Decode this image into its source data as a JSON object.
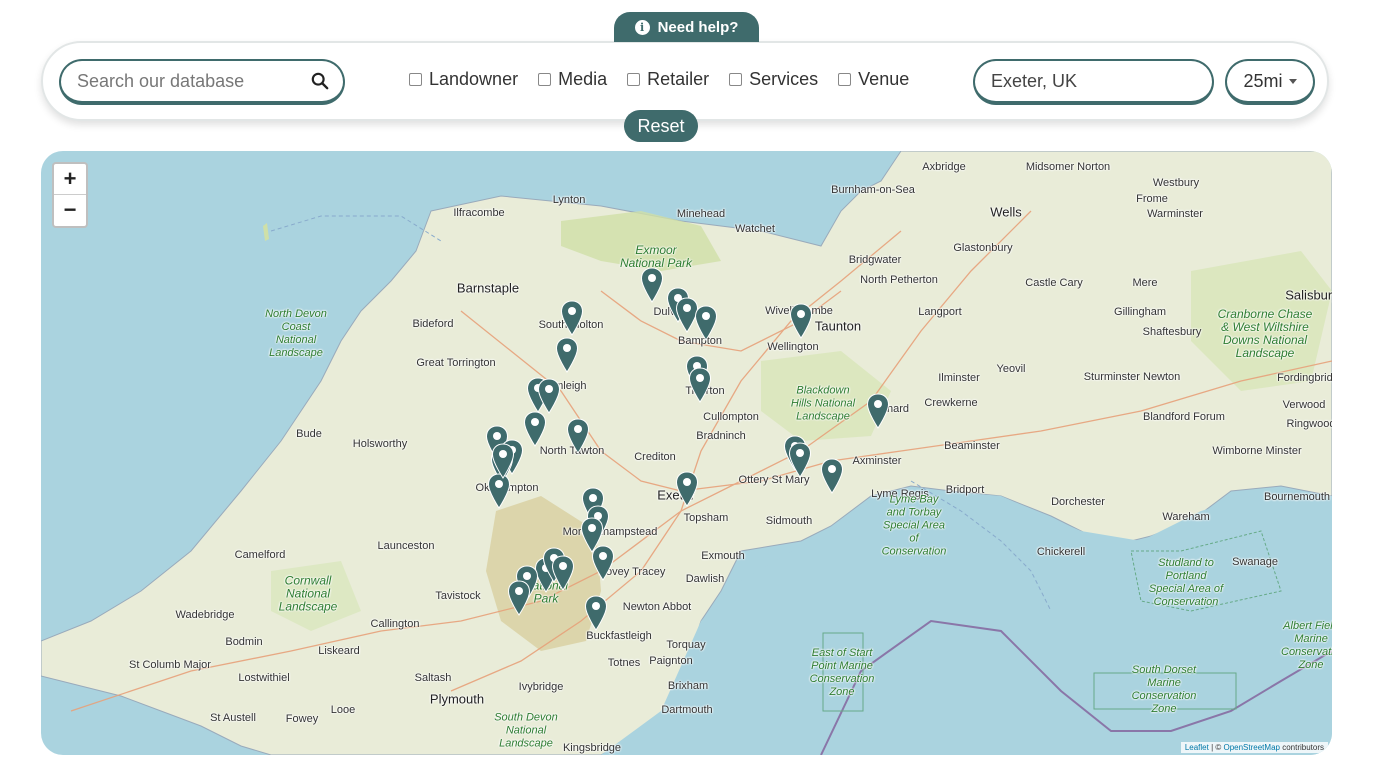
{
  "help": {
    "label": "Need help?"
  },
  "search": {
    "placeholder": "Search our database",
    "value": ""
  },
  "filters": [
    {
      "label": "Landowner",
      "checked": false
    },
    {
      "label": "Media",
      "checked": false
    },
    {
      "label": "Retailer",
      "checked": false
    },
    {
      "label": "Services",
      "checked": false
    },
    {
      "label": "Venue",
      "checked": false
    }
  ],
  "location": {
    "value": "Exeter, UK"
  },
  "radius": {
    "value": "25mi"
  },
  "reset": {
    "label": "Reset"
  },
  "map": {
    "zoom_in": "+",
    "zoom_out": "−",
    "attribution": {
      "leaflet": "Leaflet",
      "sep": " | © ",
      "osm": "OpenStreetMap",
      "rest": " contributors"
    },
    "places": [
      "Axbridge",
      "Midsomer Norton",
      "Westbury",
      "Wells",
      "Frome",
      "Warminster",
      "Burnham-on-Sea",
      "Ilfracombe",
      "Lynton",
      "Minehead",
      "Watchet",
      "Bridgwater",
      "Glastonbury",
      "Barnstaple",
      "North Petherton",
      "Castle Cary",
      "Mere",
      "Salisbury",
      "Bideford",
      "South Molton",
      "Dulverton",
      "Wiveliscombe",
      "Taunton",
      "Langport",
      "Gillingham",
      "Shaftesbury",
      "Bampton",
      "Wellington",
      "Great Torrington",
      "Chulmleigh",
      "Tiverton",
      "Ilminster",
      "Yeovil",
      "Sturminster Newton",
      "Fordingbridge",
      "Cullompton",
      "Chard",
      "Crewkerne",
      "Blandford Forum",
      "Verwood",
      "Ringwood",
      "Bude",
      "Holsworthy",
      "Bradninch",
      "North Tawton",
      "Crediton",
      "Beaminster",
      "Wimborne Minster",
      "Axminster",
      "Ottery St Mary",
      "Okehampton",
      "Exeter",
      "Lyme Regis",
      "Bridport",
      "Dorchester",
      "Bournemouth",
      "Topsham",
      "Sidmouth",
      "Wareham",
      "Moretonhampstead",
      "Exmouth",
      "Launceston",
      "Chickerell",
      "Swanage",
      "Camelford",
      "Bovey Tracey",
      "Dawlish",
      "Tavistock",
      "Newton Abbot",
      "Wadebridge",
      "Callington",
      "Buckfastleigh",
      "Bodmin",
      "Liskeard",
      "Torquay",
      "St Columb Major",
      "Totnes",
      "Paignton",
      "Lostwithiel",
      "Saltash",
      "Brixham",
      "Ivybridge",
      "Plymouth",
      "St Austell",
      "Fowey",
      "Looe",
      "Dartmouth",
      "Kingsbridge"
    ],
    "parks": [
      "Exmoor National Park",
      "North Devon Coast National Landscape",
      "Blackdown Hills National Landscape",
      "Cranborne Chase & West Wiltshire Downs National Landscape",
      "Lyme Bay and Torbay Special Area of Conservation",
      "Cornwall National Landscape",
      "Dartmoor National Park",
      "Studland to Portland Special Area of Conservation",
      "Albert Field Marine Conservation Zone",
      "East of Start Point Marine Conservation Zone",
      "South Dorset Marine Conservation Zone",
      "South Devon National Landscape"
    ],
    "marker_count": 33,
    "marker_color": "#3f6b6c"
  }
}
